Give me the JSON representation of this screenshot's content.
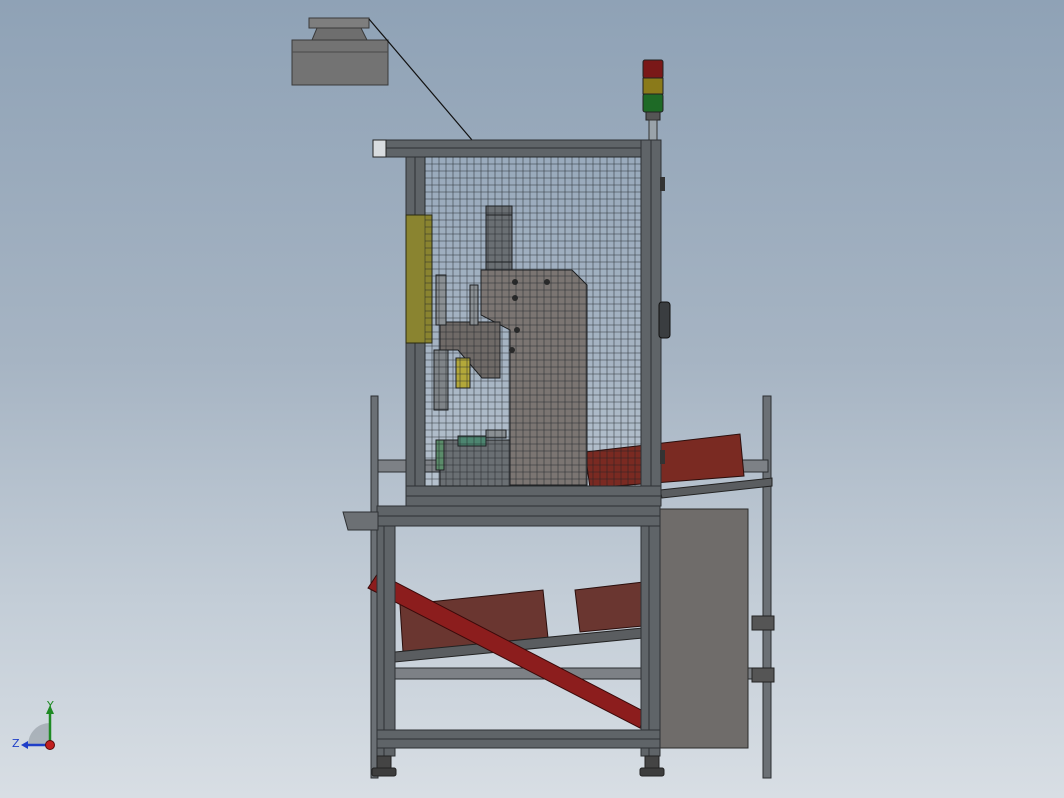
{
  "viewport": {
    "background_top": "#8fa2b6",
    "background_bottom": "#d8dee4"
  },
  "model": {
    "frame_color": "#5f6468",
    "frame_dark": "#2e3134",
    "mesh_color": "#1d2226",
    "ribbon_color": "#8c1d1d",
    "panel_color": "#6f6c6a",
    "yellow_panel_color": "#8a8430"
  },
  "signal_tower": {
    "lights": [
      "#7a1818",
      "#8a7a1a",
      "#1e6a26"
    ]
  },
  "triad": {
    "y_label": "Y",
    "z_label": "Z",
    "y_color": "#1f8a24",
    "z_color": "#1f3fc8",
    "x_color": "#c21f1f"
  }
}
